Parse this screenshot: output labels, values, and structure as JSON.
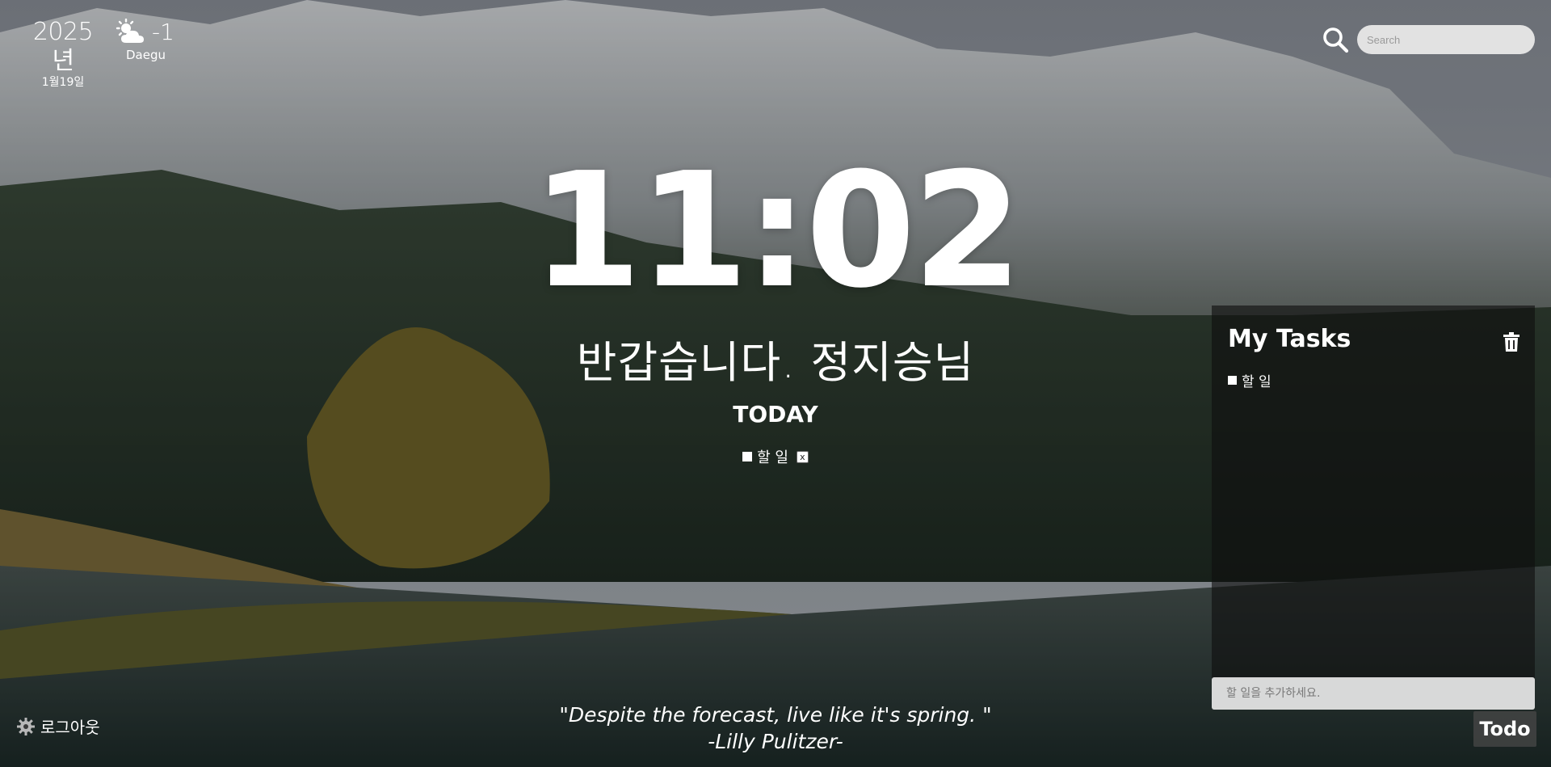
{
  "datetime": {
    "year": "2025년",
    "month_day": "1월19일"
  },
  "weather": {
    "icon": "partly-cloudy-icon",
    "temperature": "-1",
    "city": "Daegu"
  },
  "search": {
    "placeholder": "Search",
    "icon": "search-icon"
  },
  "clock": {
    "time": "11:02"
  },
  "greeting": "반갑습니다. 정지승님",
  "today": {
    "heading": "TODAY",
    "item": {
      "label": "할 일",
      "remove_label": "x"
    }
  },
  "tasks": {
    "title": "My Tasks",
    "items": [
      {
        "label": "할 일"
      }
    ],
    "input_placeholder": "할 일을 추가하세요."
  },
  "todo_toggle": "Todo",
  "logout": {
    "label": "로그아웃",
    "icon": "gear-icon"
  },
  "quote": {
    "text": "\"Despite the forecast, live like it's spring. \"",
    "author": "-Lilly Pulitzer-"
  },
  "colors": {
    "text": "#ffffff",
    "panel": "#0f0f0f",
    "input": "#e6e6e6"
  }
}
